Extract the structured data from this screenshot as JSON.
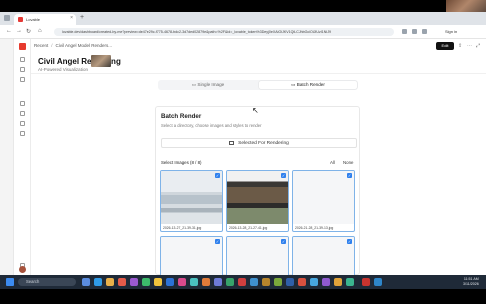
{
  "browser": {
    "tab_title": "Lovable",
    "new_tab": "+",
    "url": "lovable.dev/dashboard/created-by-me?preview=de47e29c-f775-4678-bdc2-3d7ded02879e&path=%2F&id=_lovable_token%3Deyj0eXAiOiJKV1QiLCJhbGciOiJIUzI1NiJ9",
    "sign_in": "Sign in"
  },
  "breadcrumb": {
    "recent": "Recent",
    "project": "Civil Angel Model Renders..."
  },
  "header": {
    "edit_label": "Edit"
  },
  "page": {
    "title": "Civil Angel Rendering",
    "subtitle": "AI-Powered Visualization"
  },
  "mode_tabs": {
    "single": "Single Image",
    "batch": "Batch Render",
    "active": "batch"
  },
  "batch": {
    "title": "Batch Render",
    "description": "Select a directory, choose images and styles to render",
    "selected_button": "Selected For Rendering",
    "selected_images": "Select Images (8 / 8)",
    "all": "All",
    "none": "None",
    "images": [
      {
        "caption": "2026-13-27_21-39-31.jpg",
        "checked": true
      },
      {
        "caption": "2026-13-28_21-27-41.jpg",
        "checked": true
      },
      {
        "caption": "2026-21-28_21-39-13.jpg",
        "checked": true
      },
      {
        "caption": "",
        "checked": true
      },
      {
        "caption": "",
        "checked": true
      },
      {
        "caption": "",
        "checked": true
      }
    ]
  },
  "taskbar": {
    "search": "Search",
    "time": "11:51 AM",
    "date": "3/11/2026"
  },
  "colors": {
    "accent": "#2f80ed",
    "brand": "#e63a2e"
  }
}
